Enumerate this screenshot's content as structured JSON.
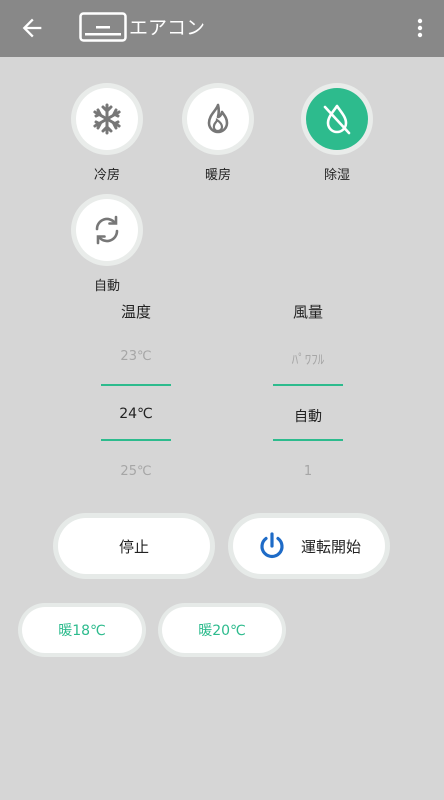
{
  "appbar": {
    "title": "エアコン",
    "back_icon": "arrow-left-icon",
    "device_icon": "air-conditioner-icon",
    "menu_icon": "more-vert-icon"
  },
  "modes": [
    {
      "label": "冷房",
      "icon": "snowflake-icon",
      "active": false
    },
    {
      "label": "暖房",
      "icon": "flame-icon",
      "active": false
    },
    {
      "label": "除湿",
      "icon": "no-drop-icon",
      "active": true
    },
    {
      "label": "自動",
      "icon": "sync-icon",
      "active": false
    }
  ],
  "temperature": {
    "title": "温度",
    "above": "23℃",
    "selected": "24℃",
    "below": "25℃"
  },
  "fan": {
    "title": "風量",
    "above": "ﾊﾟﾜﾌﾙ",
    "selected": "自動",
    "below": "1"
  },
  "actions": {
    "stop_label": "停止",
    "start_label": "運転開始",
    "start_icon": "power-icon"
  },
  "presets": [
    {
      "label": "暖18℃"
    },
    {
      "label": "暖20℃"
    }
  ],
  "colors": {
    "accent": "#2dbb8d",
    "appbar": "#888888",
    "background": "#d6d6d6",
    "power_icon": "#1e6bc7"
  }
}
